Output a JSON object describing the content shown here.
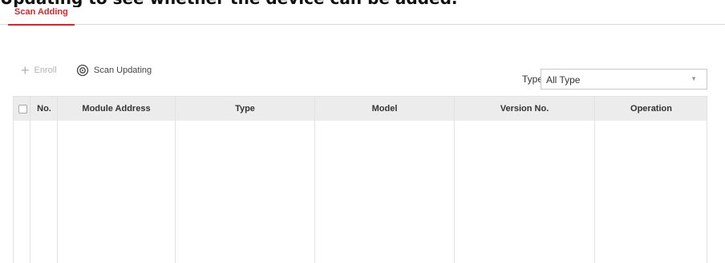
{
  "page_caption": "Updating to see whether the device can be added.",
  "tabs": [
    {
      "label": "Scan Adding",
      "active": true
    }
  ],
  "toolbar": {
    "enroll_label": "Enroll",
    "enroll_icon": "plus-icon",
    "scan_label": "Scan Updating",
    "scan_icon": "scan-refresh-icon"
  },
  "filter": {
    "label": "Type",
    "selected": "All Type",
    "icon": "dropdown-caret-icon"
  },
  "table": {
    "columns": [
      "No.",
      "Module Address",
      "Type",
      "Model",
      "Version No.",
      "Operation"
    ],
    "rows": []
  },
  "colors": {
    "accent": "#d8272e",
    "header_bg": "#ececec",
    "border": "#e2e2e2"
  }
}
